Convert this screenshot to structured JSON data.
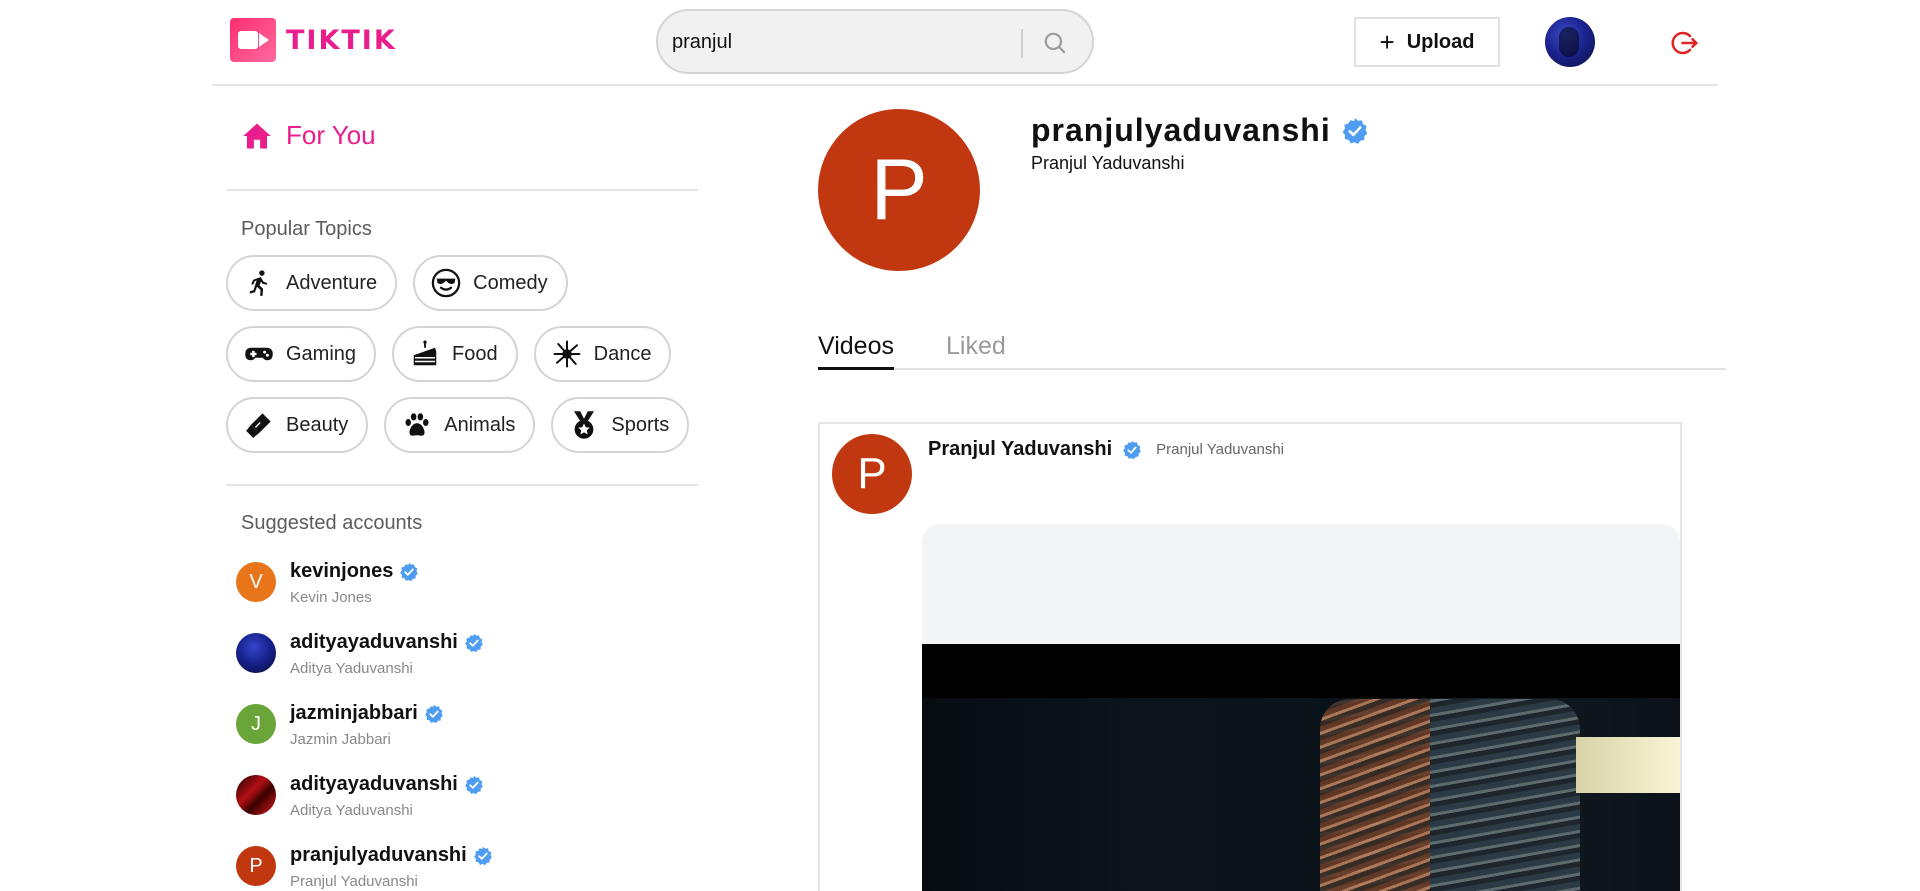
{
  "header": {
    "logo_text": "TIKTIK",
    "search": {
      "value": "pranjul",
      "placeholder": ""
    },
    "upload_label": "Upload"
  },
  "sidebar": {
    "for_you_label": "For You",
    "popular_topics_title": "Popular Topics",
    "topics": [
      {
        "label": "Adventure",
        "icon": "running-icon"
      },
      {
        "label": "Comedy",
        "icon": "sunglasses-face-icon"
      },
      {
        "label": "Gaming",
        "icon": "gamepad-icon"
      },
      {
        "label": "Food",
        "icon": "cake-icon"
      },
      {
        "label": "Dance",
        "icon": "spiral-icon"
      },
      {
        "label": "Beauty",
        "icon": "lipstick-icon"
      },
      {
        "label": "Animals",
        "icon": "paw-icon"
      },
      {
        "label": "Sports",
        "icon": "medal-icon"
      }
    ],
    "suggested_title": "Suggested accounts",
    "accounts": [
      {
        "username": "kevinjones",
        "name": "Kevin Jones",
        "initial": "V",
        "color": "#e8751a"
      },
      {
        "username": "adityayaduvanshi",
        "name": "Aditya Yaduvanshi",
        "initial": "",
        "color": "#1c2aa0"
      },
      {
        "username": "jazminjabbari",
        "name": "Jazmin Jabbari",
        "initial": "J",
        "color": "#6aa539"
      },
      {
        "username": "adityayaduvanshi",
        "name": "Aditya Yaduvanshi",
        "initial": "",
        "color": "#9e0f12"
      },
      {
        "username": "pranjulyaduvanshi",
        "name": "Pranjul Yaduvanshi",
        "initial": "P",
        "color": "#c1370f"
      }
    ]
  },
  "profile": {
    "initial": "P",
    "username": "pranjulyaduvanshi",
    "name": "Pranjul Yaduvanshi",
    "tabs": {
      "videos": "Videos",
      "liked": "Liked"
    }
  },
  "post": {
    "initial": "P",
    "display_name": "Pranjul Yaduvanshi",
    "username": "Pranjul Yaduvanshi"
  },
  "colors": {
    "brand": "#e91e8c",
    "verified": "#4e9df3",
    "avatar": "#c1370f",
    "logout": "#e02424"
  }
}
